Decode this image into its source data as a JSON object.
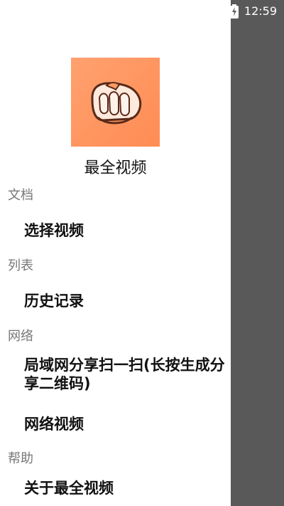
{
  "status_bar": {
    "time": "12:59",
    "battery_icon": "battery-charging-icon"
  },
  "drawer": {
    "header": {
      "app_name": "最全视频",
      "logo_icon": "fist-icon",
      "logo_bg_colors": [
        "#ffa16f",
        "#ff8c54"
      ]
    },
    "sections": [
      {
        "title": "文档",
        "items": [
          {
            "label": "选择视频"
          }
        ]
      },
      {
        "title": "列表",
        "items": [
          {
            "label": "历史记录"
          }
        ]
      },
      {
        "title": "网络",
        "items": [
          {
            "label": "局域网分享扫一扫(长按生成分享二维码)"
          },
          {
            "label": "网络视频"
          }
        ]
      },
      {
        "title": "帮助",
        "items": [
          {
            "label": "关于最全视频"
          }
        ]
      }
    ]
  }
}
